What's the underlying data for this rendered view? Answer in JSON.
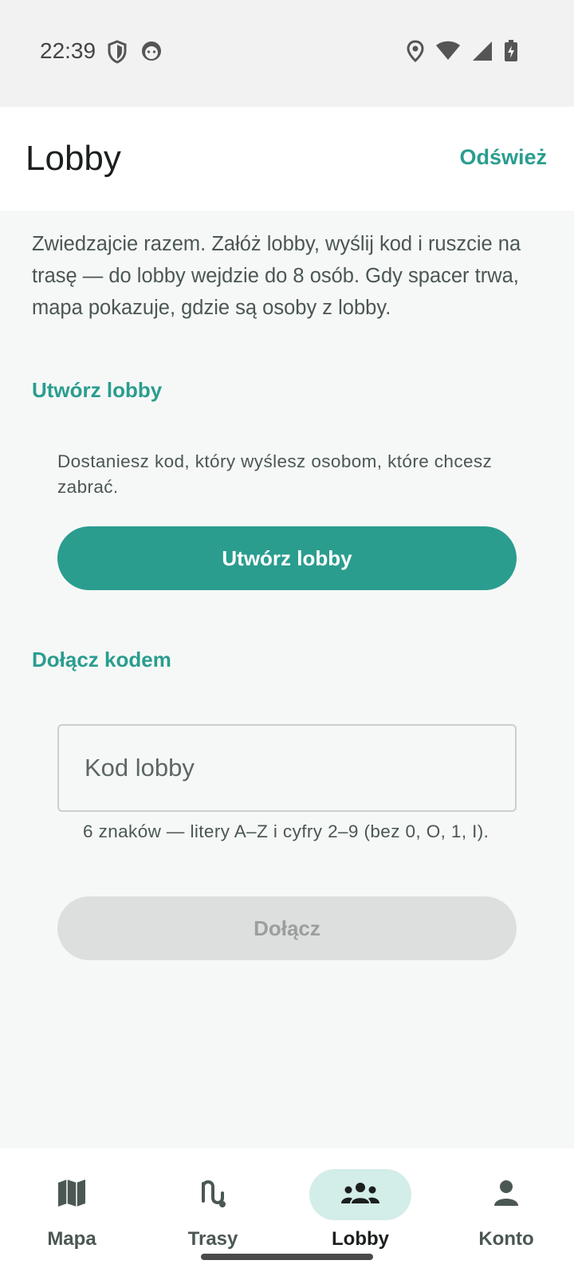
{
  "status_bar": {
    "time": "22:39",
    "left_icons": [
      "shield-icon",
      "android-face-icon"
    ],
    "right_icons": [
      "location-icon",
      "wifi-icon",
      "cell-signal-icon",
      "battery-charging-icon"
    ]
  },
  "app_bar": {
    "title": "Lobby",
    "refresh_label": "Odśwież"
  },
  "intro": "Zwiedzajcie razem. Załóż lobby, wyślij kod i ruszcie na trasę — do lobby wejdzie do 8 osób. Gdy spacer trwa, mapa pokazuje, gdzie są osoby z lobby.",
  "create_section": {
    "header": "Utwórz lobby",
    "hint": "Dostaniesz kod, który wyślesz osobom, które chcesz zabrać.",
    "button_label": "Utwórz lobby"
  },
  "join_section": {
    "header": "Dołącz kodem",
    "input_placeholder": "Kod lobby",
    "input_value": "",
    "hint": "6 znaków — litery A–Z i cyfry 2–9 (bez 0, O, 1, I).",
    "button_label": "Dołącz"
  },
  "bottom_nav": {
    "items": [
      {
        "label": "Mapa",
        "icon": "map-icon",
        "active": false
      },
      {
        "label": "Trasy",
        "icon": "route-icon",
        "active": false
      },
      {
        "label": "Lobby",
        "icon": "group-icon",
        "active": true
      },
      {
        "label": "Konto",
        "icon": "person-icon",
        "active": false
      }
    ]
  },
  "colors": {
    "accent": "#2a9d8f",
    "active_nav_bg": "#d3ede8",
    "disabled_button_bg": "#dcdfdd"
  }
}
